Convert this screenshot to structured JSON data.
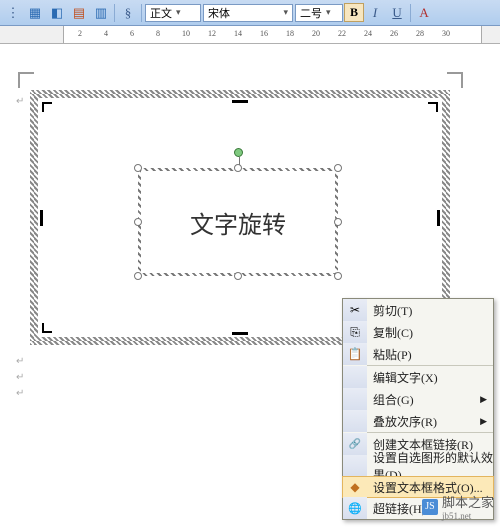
{
  "toolbar": {
    "style_label": "正文",
    "font_label": "宋体",
    "size_label": "二号",
    "bold": "B",
    "italic": "I",
    "underline": "U",
    "strike": "A"
  },
  "ruler": {
    "ticks": [
      "2",
      "4",
      "6",
      "8",
      "10",
      "12",
      "14",
      "16",
      "18",
      "20",
      "22",
      "24",
      "26",
      "28",
      "30"
    ]
  },
  "textbox": {
    "content": "文字旋转"
  },
  "context_menu": {
    "cut": "剪切(T)",
    "copy": "复制(C)",
    "paste": "粘贴(P)",
    "edit_text": "编辑文字(X)",
    "group": "组合(G)",
    "order": "叠放次序(R)",
    "create_link": "创建文本框链接(R)",
    "autoshape_default": "设置自选图形的默认效果(D)",
    "format_textbox": "设置文本框格式(O)...",
    "hyperlink": "超链接(H)..."
  },
  "watermark": {
    "text": "脚本之家",
    "url": "jb51.net"
  }
}
